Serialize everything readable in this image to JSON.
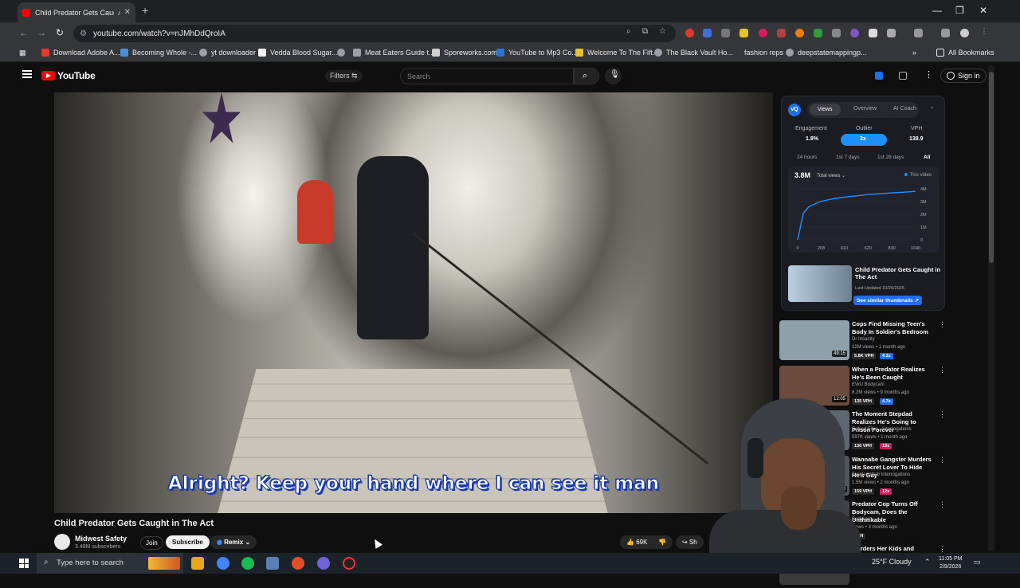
{
  "browser": {
    "tab_title": "Child Predator Gets Caught",
    "url": "youtube.com/watch?v=nJMhDdQroIA",
    "bookmarks": [
      {
        "label": "Download Adobe A...",
        "color": "#e8372c"
      },
      {
        "label": "Becoming Whole -...",
        "color": "#4a90d9"
      },
      {
        "label": "yt downloader",
        "color": "#9aa0a6"
      },
      {
        "label": "Vedda Blood Sugar...",
        "color": "#f1f1f1"
      },
      {
        "label": "Meat Eaters Guide t...",
        "color": "#9aa0a6"
      },
      {
        "label": "Sporeworks.com",
        "color": "#d0d0d0"
      },
      {
        "label": "YouTube to Mp3 Co...",
        "color": "#2f6fd8"
      },
      {
        "label": "Welcome To The Fift...",
        "color": "#e6c229"
      },
      {
        "label": "The Black Vault Ho...",
        "color": "#9aa0a6"
      },
      {
        "label": "fashion reps",
        "color": ""
      },
      {
        "label": "deepstatemappingp...",
        "color": "#9aa0a6"
      }
    ],
    "all_bookmarks": "All Bookmarks"
  },
  "youtube": {
    "logo_text": "YouTube",
    "filters_label": "Filters",
    "search_placeholder": "Search",
    "signin_label": "Sign in"
  },
  "video": {
    "caption": "Alright? Keep your hand where I can see it man",
    "title": "Child Predator Gets Caught in The Act",
    "channel": "Midwest Safety",
    "subscribers": "3.48M subscribers",
    "join_label": "Join",
    "subscribe_label": "Subscribe",
    "remix_label": "Remix",
    "likes": "69K",
    "share_label": "Sh"
  },
  "panel": {
    "tabs": [
      "Views",
      "Overview",
      "AI Coach"
    ],
    "metrics": [
      {
        "label": "Engagement",
        "value": "1.8%"
      },
      {
        "label": "Outlier",
        "value": "3x"
      },
      {
        "label": "VPH",
        "value": "138.9"
      }
    ],
    "periods": [
      "24 hours",
      "1st 7 days",
      "1st 28 days",
      "All"
    ],
    "total_views": "3.8M",
    "views_selector": "Total views",
    "legend": "This video",
    "thumb_title": "Child Predator Gets Caught in The Act",
    "thumb_date": "Last Updated 10/26/2025",
    "see_similar": "See similar thumbnails"
  },
  "chart_data": {
    "type": "line",
    "x": [
      0,
      50,
      100,
      200,
      300,
      410,
      520,
      620,
      730,
      830,
      940,
      1040
    ],
    "ticks_x": [
      "0",
      "208",
      "410",
      "620",
      "830",
      "1040"
    ],
    "ticks_y": [
      "0",
      "1M",
      "2M",
      "3M",
      "4M"
    ],
    "series": [
      {
        "name": "This video",
        "values": [
          0,
          2.1,
          2.6,
          3.0,
          3.2,
          3.35,
          3.45,
          3.55,
          3.62,
          3.68,
          3.74,
          3.8
        ]
      }
    ],
    "ylim": [
      0,
      4
    ],
    "xlim": [
      0,
      1040
    ]
  },
  "recommended": [
    {
      "title": "Cops Find Missing Teen's Body In Soldier's Bedroom",
      "channel": "Dr Insanity",
      "meta": "12M views • 1 month ago",
      "vph": "5.8K VPH",
      "mult": "4.1x",
      "duration": "49:15",
      "mult_color": "#1e6fe8",
      "thumb": "#8fa1a8"
    },
    {
      "title": "When a Predator Realizes He's Been Caught",
      "channel": "EWU Bodycam",
      "meta": "8.2M views • 9 months ago",
      "vph": "135 VPH",
      "mult": "4.7x",
      "duration": "12:05",
      "mult_color": "#1e6fe8",
      "thumb": "#6b4b3e"
    },
    {
      "title": "The Moment Stepdad Realizes He's Going to Prison Forever",
      "channel": "Solved Files - Interrogations",
      "meta": "597K views • 1 month ago",
      "vph": "130 VPH",
      "mult": "19x",
      "duration": "",
      "mult_color": "#d81b60",
      "thumb": "#5f6770"
    },
    {
      "title": "Wannabe Gangster Murders His Secret Lover To Hide He's Gay",
      "channel": "Tangled Web Interrogations",
      "meta": "1.5M views • 2 months ago",
      "vph": "159 VPH",
      "mult": "12x",
      "duration": "53:33",
      "mult_color": "#d81b60",
      "thumb": "#4f555c"
    },
    {
      "title": "Predator Cop Turns Off Bodycam, Does the Unthinkable",
      "channel": "Bodycam",
      "meta": "views • 3 months ago",
      "vph": "VPH",
      "mult": "",
      "duration": "",
      "mult_color": "#d81b60",
      "thumb": "#3e4349"
    },
    {
      "title": "Murders Her Kids and",
      "channel": "",
      "meta": "",
      "vph": "",
      "mult": "",
      "duration": "",
      "mult_color": "",
      "thumb": "#3a3a3a"
    }
  ],
  "taskbar": {
    "search_placeholder": "Type here to search",
    "weather": "25°F  Cloudy",
    "time": "11:05 PM",
    "date": "2/9/2026"
  }
}
